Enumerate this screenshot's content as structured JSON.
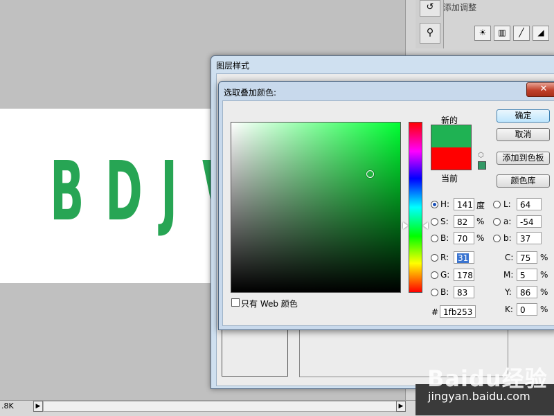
{
  "canvas": {
    "letters": [
      "B",
      "D",
      "J",
      "V"
    ],
    "text_color": "#27a554"
  },
  "adjustments_panel": {
    "title": "添加调整",
    "buttons": [
      "☀",
      "▥",
      "╱",
      "◢"
    ]
  },
  "layer_style_dialog": {
    "title": "图层样式"
  },
  "color_picker": {
    "title": "选取叠加颜色:",
    "close_label": "✕",
    "new_label": "新的",
    "current_label": "当前",
    "new_color": "#1fb253",
    "current_color": "#ff0000",
    "buttons": {
      "ok": "确定",
      "cancel": "取消",
      "add_to_swatches": "添加到色板",
      "color_libraries": "颜色库"
    },
    "hsb": {
      "h": {
        "label": "H:",
        "value": "141",
        "unit": "度"
      },
      "s": {
        "label": "S:",
        "value": "82",
        "unit": "%"
      },
      "b": {
        "label": "B:",
        "value": "70",
        "unit": "%"
      }
    },
    "rgb": {
      "r": {
        "label": "R:",
        "value": "31"
      },
      "g": {
        "label": "G:",
        "value": "178"
      },
      "b": {
        "label": "B:",
        "value": "83"
      }
    },
    "lab": {
      "l": {
        "label": "L:",
        "value": "64"
      },
      "a": {
        "label": "a:",
        "value": "-54"
      },
      "b": {
        "label": "b:",
        "value": "37"
      }
    },
    "cmyk": {
      "c": {
        "label": "C:",
        "value": "75",
        "unit": "%"
      },
      "m": {
        "label": "M:",
        "value": "5",
        "unit": "%"
      },
      "y": {
        "label": "Y:",
        "value": "86",
        "unit": "%"
      },
      "k": {
        "label": "K:",
        "value": "0",
        "unit": "%"
      }
    },
    "hex": {
      "label": "#",
      "value": "1fb253"
    },
    "web_only_label": "只有 Web 颜色",
    "selected_mode": "H"
  },
  "status_bar": {
    "zoom_text": ".8K"
  },
  "watermark": {
    "logo": "Baidu经验",
    "url": "jingyan.baidu.com"
  }
}
